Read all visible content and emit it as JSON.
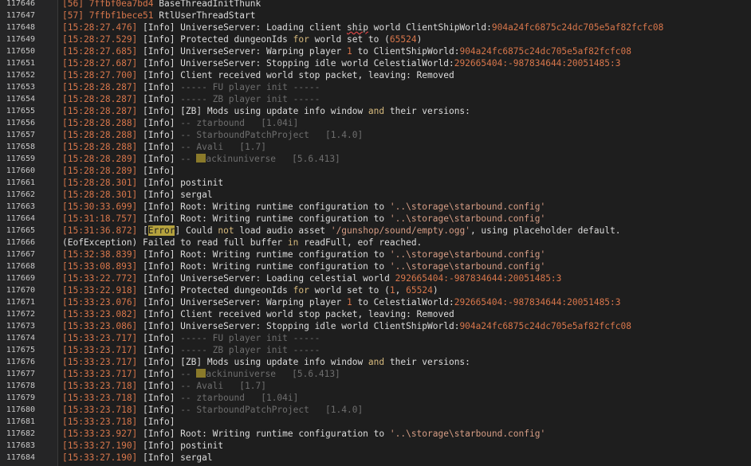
{
  "lines": [
    {
      "n": "117646",
      "tokens": [
        {
          "t": "[56] ",
          "c": "num"
        },
        {
          "t": "7ffbf0ea7bd4",
          "c": "hex"
        },
        {
          "t": " BaseThreadInitThunk",
          "c": ""
        }
      ]
    },
    {
      "n": "117647",
      "tokens": [
        {
          "t": "[57] ",
          "c": "num"
        },
        {
          "t": "7ffbf1bece51",
          "c": "hex"
        },
        {
          "t": " RtlUserThreadStart",
          "c": ""
        }
      ]
    },
    {
      "n": "117648",
      "tokens": [
        {
          "t": "[15:28:27.476]",
          "c": "ts"
        },
        {
          "t": " [Info] UniverseServer: Loading client ",
          "c": ""
        },
        {
          "t": "ship",
          "c": "squig"
        },
        {
          "t": " world ClientShipWorld:",
          "c": ""
        },
        {
          "t": "904a24fc6875c24dc705e5af82fcfc08",
          "c": "hex"
        }
      ]
    },
    {
      "n": "117649",
      "tokens": [
        {
          "t": "[15:28:27.529]",
          "c": "ts"
        },
        {
          "t": " [Info] Protected dungeonIds ",
          "c": ""
        },
        {
          "t": "for",
          "c": "kw"
        },
        {
          "t": " world set to (",
          "c": ""
        },
        {
          "t": "65524",
          "c": "num"
        },
        {
          "t": ")",
          "c": ""
        }
      ]
    },
    {
      "n": "117650",
      "tokens": [
        {
          "t": "[15:28:27.685]",
          "c": "ts"
        },
        {
          "t": " [Info] UniverseServer: Warping player ",
          "c": ""
        },
        {
          "t": "1",
          "c": "num"
        },
        {
          "t": " to ClientShipWorld:",
          "c": ""
        },
        {
          "t": "904a24fc6875c24dc705e5af82fcfc08",
          "c": "hex"
        }
      ]
    },
    {
      "n": "117651",
      "tokens": [
        {
          "t": "[15:28:27.687]",
          "c": "ts"
        },
        {
          "t": " [Info] UniverseServer: Stopping idle world CelestialWorld:",
          "c": ""
        },
        {
          "t": "292665404:-987834644:20051485:3",
          "c": "hex"
        }
      ]
    },
    {
      "n": "117652",
      "tokens": [
        {
          "t": "[15:28:27.700]",
          "c": "ts"
        },
        {
          "t": " [Info] Client received world stop packet, leaving: Removed",
          "c": ""
        }
      ]
    },
    {
      "n": "117653",
      "tokens": [
        {
          "t": "[15:28:28.287]",
          "c": "ts"
        },
        {
          "t": " [Info] ",
          "c": ""
        },
        {
          "t": "----- FU player init -----",
          "c": "cmt"
        }
      ]
    },
    {
      "n": "117654",
      "tokens": [
        {
          "t": "[15:28:28.287]",
          "c": "ts"
        },
        {
          "t": " [Info] ",
          "c": ""
        },
        {
          "t": "----- ZB player init -----",
          "c": "cmt"
        }
      ]
    },
    {
      "n": "117655",
      "tokens": [
        {
          "t": "[15:28:28.287]",
          "c": "ts"
        },
        {
          "t": " [Info] [ZB] Mods using update info window ",
          "c": ""
        },
        {
          "t": "and",
          "c": "kw"
        },
        {
          "t": " their versions:",
          "c": ""
        }
      ]
    },
    {
      "n": "117656",
      "tokens": [
        {
          "t": "[15:28:28.288]",
          "c": "ts"
        },
        {
          "t": " [Info] ",
          "c": ""
        },
        {
          "t": "-- ztarbound   [1.04i]",
          "c": "cmt"
        }
      ]
    },
    {
      "n": "117657",
      "tokens": [
        {
          "t": "[15:28:28.288]",
          "c": "ts"
        },
        {
          "t": " [Info] ",
          "c": ""
        },
        {
          "t": "-- StarboundPatchProject   [1.4.0]",
          "c": "cmt"
        }
      ]
    },
    {
      "n": "117658",
      "tokens": [
        {
          "t": "[15:28:28.288]",
          "c": "ts"
        },
        {
          "t": " [Info] ",
          "c": ""
        },
        {
          "t": "-- Avali   [1.7]",
          "c": "cmt"
        }
      ]
    },
    {
      "n": "117659",
      "tokens": [
        {
          "t": "[15:28:28.289]",
          "c": "ts"
        },
        {
          "t": " [Info] ",
          "c": ""
        },
        {
          "t": "-- ",
          "c": "cmt"
        },
        {
          "t": "",
          "c": "chip"
        },
        {
          "t": "ackinuniverse   [5.6.413]",
          "c": "cmt"
        }
      ]
    },
    {
      "n": "117660",
      "tokens": [
        {
          "t": "[15:28:28.289]",
          "c": "ts"
        },
        {
          "t": " [Info]",
          "c": ""
        }
      ]
    },
    {
      "n": "117661",
      "tokens": [
        {
          "t": "[15:28:28.301]",
          "c": "ts"
        },
        {
          "t": " [Info] postinit",
          "c": ""
        }
      ]
    },
    {
      "n": "117662",
      "tokens": [
        {
          "t": "[15:28:28.301]",
          "c": "ts"
        },
        {
          "t": " [Info] sergal",
          "c": ""
        }
      ]
    },
    {
      "n": "117663",
      "tokens": [
        {
          "t": "[15:30:33.699]",
          "c": "ts"
        },
        {
          "t": " [Info] Root: Writing runtime configuration to ",
          "c": ""
        },
        {
          "t": "'..\\storage\\starbound.config'",
          "c": "str"
        }
      ]
    },
    {
      "n": "117664",
      "tokens": [
        {
          "t": "[15:31:18.757]",
          "c": "ts"
        },
        {
          "t": " [Info] Root: Writing runtime configuration to ",
          "c": ""
        },
        {
          "t": "'..\\storage\\starbound.config'",
          "c": "str"
        }
      ]
    },
    {
      "n": "117665",
      "tokens": [
        {
          "t": "[15:31:36.872]",
          "c": "ts"
        },
        {
          "t": " [",
          "c": ""
        },
        {
          "t": "Error",
          "c": "err"
        },
        {
          "t": "] Could ",
          "c": ""
        },
        {
          "t": "not",
          "c": "kw"
        },
        {
          "t": " load audio asset ",
          "c": ""
        },
        {
          "t": "'/gunshop/sound/empty.ogg'",
          "c": "str"
        },
        {
          "t": ", using placeholder default.",
          "c": ""
        }
      ]
    },
    {
      "n": "117666",
      "tokens": [
        {
          "t": "(EofException) Failed to read full buffer ",
          "c": ""
        },
        {
          "t": "in",
          "c": "kw"
        },
        {
          "t": " readFull, eof reached.",
          "c": ""
        }
      ]
    },
    {
      "n": "117667",
      "tokens": [
        {
          "t": "[15:32:38.839]",
          "c": "ts"
        },
        {
          "t": " [Info] Root: Writing runtime configuration to ",
          "c": ""
        },
        {
          "t": "'..\\storage\\starbound.config'",
          "c": "str"
        }
      ]
    },
    {
      "n": "117668",
      "tokens": [
        {
          "t": "[15:33:08.893]",
          "c": "ts"
        },
        {
          "t": " [Info] Root: Writing runtime configuration to ",
          "c": ""
        },
        {
          "t": "'..\\storage\\starbound.config'",
          "c": "str"
        }
      ]
    },
    {
      "n": "117669",
      "tokens": [
        {
          "t": "[15:33:22.772]",
          "c": "ts"
        },
        {
          "t": " [Info] UniverseServer: Loading celestial world ",
          "c": ""
        },
        {
          "t": "292665404:-987834644:20051485:3",
          "c": "hex"
        }
      ]
    },
    {
      "n": "117670",
      "tokens": [
        {
          "t": "[15:33:22.918]",
          "c": "ts"
        },
        {
          "t": " [Info] Protected dungeonIds ",
          "c": ""
        },
        {
          "t": "for",
          "c": "kw"
        },
        {
          "t": " world set to (",
          "c": ""
        },
        {
          "t": "1",
          "c": "num"
        },
        {
          "t": ", ",
          "c": ""
        },
        {
          "t": "65524",
          "c": "num"
        },
        {
          "t": ")",
          "c": ""
        }
      ]
    },
    {
      "n": "117671",
      "tokens": [
        {
          "t": "[15:33:23.076]",
          "c": "ts"
        },
        {
          "t": " [Info] UniverseServer: Warping player ",
          "c": ""
        },
        {
          "t": "1",
          "c": "num"
        },
        {
          "t": " to CelestialWorld:",
          "c": ""
        },
        {
          "t": "292665404:-987834644:20051485:3",
          "c": "hex"
        }
      ]
    },
    {
      "n": "117672",
      "tokens": [
        {
          "t": "[15:33:23.082]",
          "c": "ts"
        },
        {
          "t": " [Info] Client received world stop packet, leaving: Removed",
          "c": ""
        }
      ]
    },
    {
      "n": "117673",
      "tokens": [
        {
          "t": "[15:33:23.086]",
          "c": "ts"
        },
        {
          "t": " [Info] UniverseServer: Stopping idle world ClientShipWorld:",
          "c": ""
        },
        {
          "t": "904a24fc6875c24dc705e5af82fcfc08",
          "c": "hex"
        }
      ]
    },
    {
      "n": "117674",
      "tokens": [
        {
          "t": "[15:33:23.717]",
          "c": "ts"
        },
        {
          "t": " [Info] ",
          "c": ""
        },
        {
          "t": "----- FU player init -----",
          "c": "cmt"
        }
      ]
    },
    {
      "n": "117675",
      "tokens": [
        {
          "t": "[15:33:23.717]",
          "c": "ts"
        },
        {
          "t": " [Info] ",
          "c": ""
        },
        {
          "t": "----- ZB player init -----",
          "c": "cmt"
        }
      ]
    },
    {
      "n": "117676",
      "tokens": [
        {
          "t": "[15:33:23.717]",
          "c": "ts"
        },
        {
          "t": " [Info] [ZB] Mods using update info window ",
          "c": ""
        },
        {
          "t": "and",
          "c": "kw"
        },
        {
          "t": " their versions:",
          "c": ""
        }
      ]
    },
    {
      "n": "117677",
      "tokens": [
        {
          "t": "[15:33:23.717]",
          "c": "ts"
        },
        {
          "t": " [Info] ",
          "c": ""
        },
        {
          "t": "-- ",
          "c": "cmt"
        },
        {
          "t": "",
          "c": "chip"
        },
        {
          "t": "ackinuniverse   [5.6.413]",
          "c": "cmt"
        }
      ]
    },
    {
      "n": "117678",
      "tokens": [
        {
          "t": "[15:33:23.718]",
          "c": "ts"
        },
        {
          "t": " [Info] ",
          "c": ""
        },
        {
          "t": "-- Avali   [1.7]",
          "c": "cmt"
        }
      ]
    },
    {
      "n": "117679",
      "tokens": [
        {
          "t": "[15:33:23.718]",
          "c": "ts"
        },
        {
          "t": " [Info] ",
          "c": ""
        },
        {
          "t": "-- ztarbound   [1.04i]",
          "c": "cmt"
        }
      ]
    },
    {
      "n": "117680",
      "tokens": [
        {
          "t": "[15:33:23.718]",
          "c": "ts"
        },
        {
          "t": " [Info] ",
          "c": ""
        },
        {
          "t": "-- StarboundPatchProject   [1.4.0]",
          "c": "cmt"
        }
      ]
    },
    {
      "n": "117681",
      "tokens": [
        {
          "t": "[15:33:23.718]",
          "c": "ts"
        },
        {
          "t": " [Info]",
          "c": ""
        }
      ]
    },
    {
      "n": "117682",
      "tokens": [
        {
          "t": "[15:33:23.927]",
          "c": "ts"
        },
        {
          "t": " [Info] Root: Writing runtime configuration to ",
          "c": ""
        },
        {
          "t": "'..\\storage\\starbound.config'",
          "c": "str"
        }
      ]
    },
    {
      "n": "117683",
      "tokens": [
        {
          "t": "[15:33:27.190]",
          "c": "ts"
        },
        {
          "t": " [Info] postinit",
          "c": ""
        }
      ]
    },
    {
      "n": "117684",
      "tokens": [
        {
          "t": "[15:33:27.190]",
          "c": "ts"
        },
        {
          "t": " [Info] sergal",
          "c": ""
        }
      ]
    }
  ]
}
